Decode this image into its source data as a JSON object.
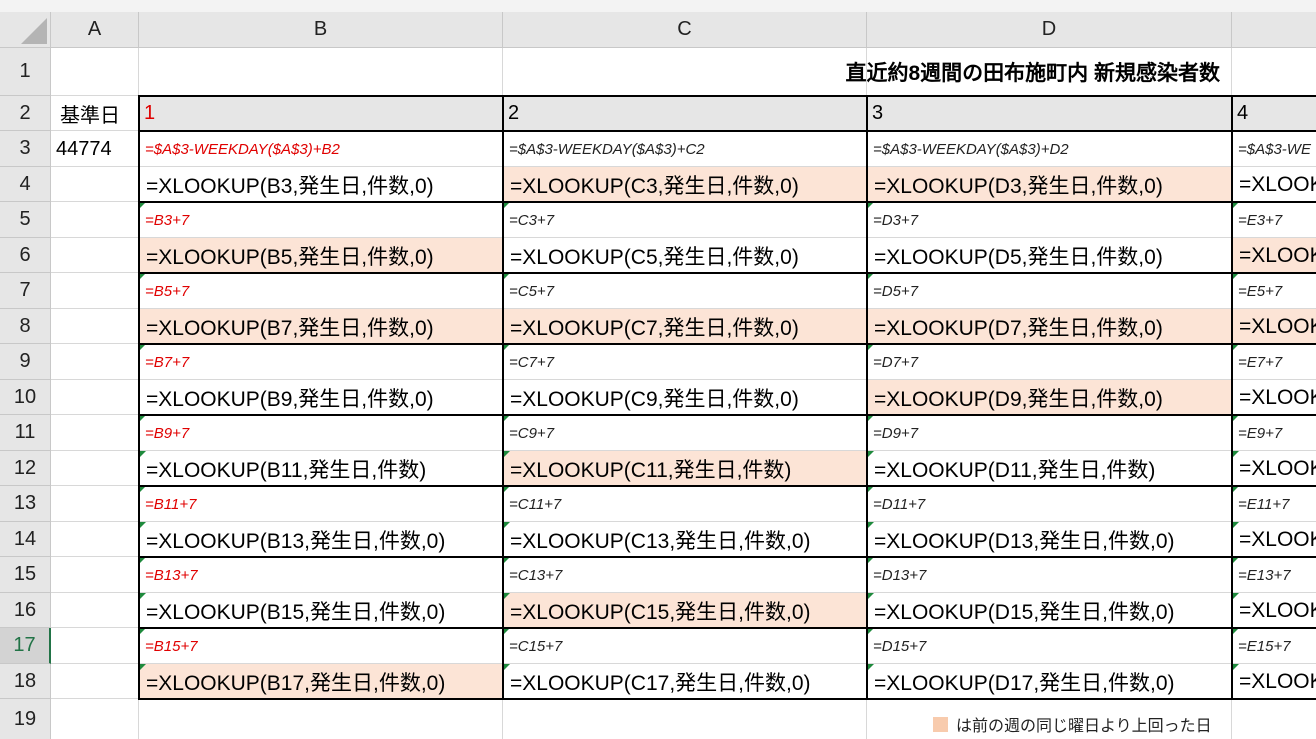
{
  "columns": [
    "A",
    "B",
    "C",
    "D"
  ],
  "rows": [
    "1",
    "2",
    "3",
    "4",
    "5",
    "6",
    "7",
    "8",
    "9",
    "10",
    "11",
    "12",
    "13",
    "14",
    "15",
    "16",
    "17",
    "18",
    "19"
  ],
  "active_row": "17",
  "title": "直近約8週間の田布施町内 新規感染者数",
  "a2": "基準日",
  "a3": "44774",
  "day_headers": [
    "1",
    "2",
    "3",
    "4"
  ],
  "grid_rows": [
    {
      "small": [
        "=$A$3-WEEKDAY($A$3)+B2",
        "=$A$3-WEEKDAY($A$3)+C2",
        "=$A$3-WEEKDAY($A$3)+D2",
        "=$A$3-WE"
      ],
      "big": [
        "=XLOOKUP(B3,発生日,件数,0)",
        "=XLOOKUP(C3,発生日,件数,0)",
        "=XLOOKUP(D3,発生日,件数,0)",
        "=XLOOK"
      ]
    },
    {
      "small": [
        "=B3+7",
        "=C3+7",
        "=D3+7",
        "=E3+7"
      ],
      "big": [
        "=XLOOKUP(B5,発生日,件数,0)",
        "=XLOOKUP(C5,発生日,件数,0)",
        "=XLOOKUP(D5,発生日,件数,0)",
        "=XLOOK"
      ]
    },
    {
      "small": [
        "=B5+7",
        "=C5+7",
        "=D5+7",
        "=E5+7"
      ],
      "big": [
        "=XLOOKUP(B7,発生日,件数,0)",
        "=XLOOKUP(C7,発生日,件数,0)",
        "=XLOOKUP(D7,発生日,件数,0)",
        "=XLOOK"
      ]
    },
    {
      "small": [
        "=B7+7",
        "=C7+7",
        "=D7+7",
        "=E7+7"
      ],
      "big": [
        "=XLOOKUP(B9,発生日,件数,0)",
        "=XLOOKUP(C9,発生日,件数,0)",
        "=XLOOKUP(D9,発生日,件数,0)",
        "=XLOOK"
      ]
    },
    {
      "small": [
        "=B9+7",
        "=C9+7",
        "=D9+7",
        "=E9+7"
      ],
      "big": [
        "=XLOOKUP(B11,発生日,件数)",
        "=XLOOKUP(C11,発生日,件数)",
        "=XLOOKUP(D11,発生日,件数)",
        "=XLOOK"
      ]
    },
    {
      "small": [
        "=B11+7",
        "=C11+7",
        "=D11+7",
        "=E11+7"
      ],
      "big": [
        "=XLOOKUP(B13,発生日,件数,0)",
        "=XLOOKUP(C13,発生日,件数,0)",
        "=XLOOKUP(D13,発生日,件数,0)",
        "=XLOOK"
      ]
    },
    {
      "small": [
        "=B13+7",
        "=C13+7",
        "=D13+7",
        "=E13+7"
      ],
      "big": [
        "=XLOOKUP(B15,発生日,件数,0)",
        "=XLOOKUP(C15,発生日,件数,0)",
        "=XLOOKUP(D15,発生日,件数,0)",
        "=XLOOK"
      ]
    },
    {
      "small": [
        "=B15+7",
        "=C15+7",
        "=D15+7",
        "=E15+7"
      ],
      "big": [
        "=XLOOKUP(B17,発生日,件数,0)",
        "=XLOOKUP(C17,発生日,件数,0)",
        "=XLOOKUP(D17,発生日,件数,0)",
        "=XLOOK"
      ]
    }
  ],
  "highlight": [
    [
      false,
      true,
      true,
      false
    ],
    [
      true,
      false,
      false,
      true
    ],
    [
      true,
      true,
      true,
      true
    ],
    [
      false,
      false,
      true,
      false
    ],
    [
      false,
      true,
      false,
      false
    ],
    [
      false,
      false,
      false,
      false
    ],
    [
      false,
      true,
      false,
      false
    ],
    [
      true,
      false,
      false,
      false
    ]
  ],
  "legend": "は前の週の同じ曜日より上回った日",
  "colors": {
    "highlight": "#fce4d6",
    "legend_swatch": "#f8cbad",
    "red_text": "#e00000",
    "comment_marker": "#1e8a3c"
  }
}
